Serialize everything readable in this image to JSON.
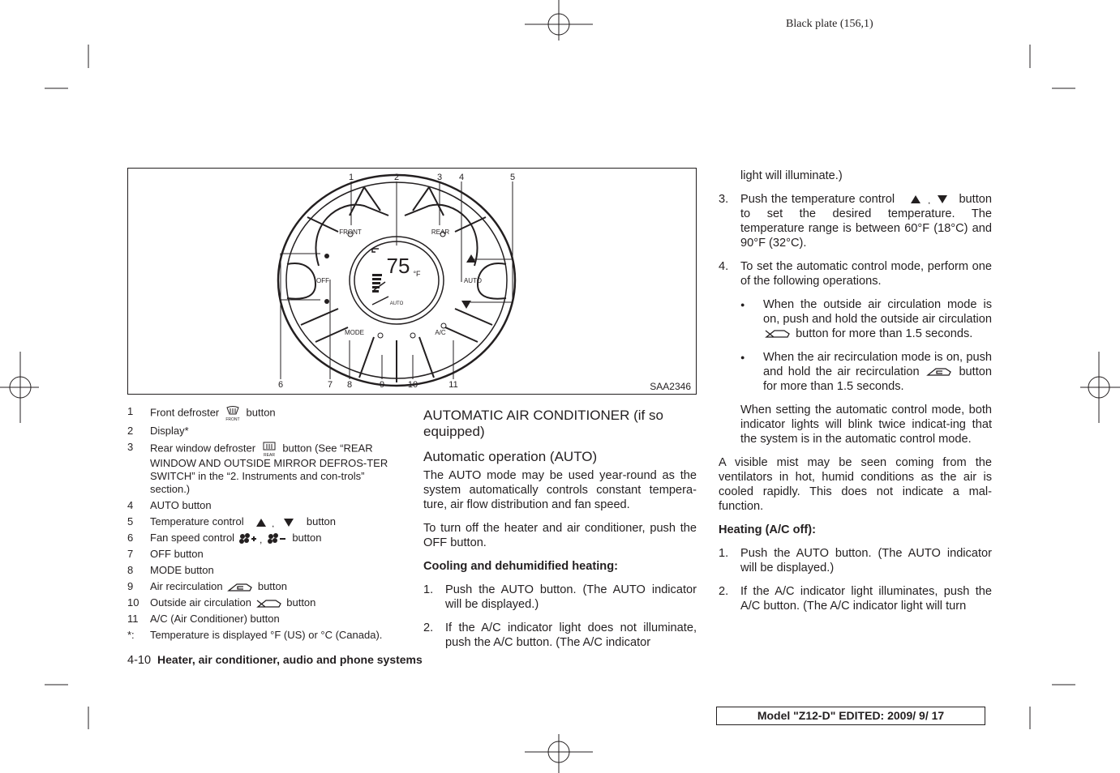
{
  "plate": "Black plate (156,1)",
  "figure": {
    "code": "SAA2346",
    "callouts": [
      "1",
      "2",
      "3",
      "4",
      "5",
      "6",
      "7",
      "8",
      "9",
      "10",
      "11"
    ],
    "labels": {
      "front": "FRONT",
      "rear": "REAR",
      "off": "OFF",
      "auto": "AUTO",
      "mode": "MODE",
      "ac": "A/C",
      "temp": "75",
      "unit": "°F",
      "display_auto": "AUTO"
    }
  },
  "legend": [
    {
      "n": "1",
      "pre": "Front defroster",
      "icon": "front-defroster-icon",
      "post": "button"
    },
    {
      "n": "2",
      "pre": "Display*"
    },
    {
      "n": "3",
      "pre": "Rear window defroster",
      "icon": "rear-defroster-icon",
      "post": "button (See “REAR WINDOW AND OUTSIDE MIRROR DEFROS-TER SWITCH” in the “2. Instruments and con-trols” section.)"
    },
    {
      "n": "4",
      "pre": "AUTO button"
    },
    {
      "n": "5",
      "pre": "Temperature control",
      "icon": "up-down-triangle-icon",
      "post": "button"
    },
    {
      "n": "6",
      "pre": "Fan speed control",
      "icon": "fan-plus-minus-icon",
      "post": "button"
    },
    {
      "n": "7",
      "pre": "OFF button"
    },
    {
      "n": "8",
      "pre": "MODE button"
    },
    {
      "n": "9",
      "pre": "Air recirculation",
      "icon": "recirculation-icon",
      "post": "button"
    },
    {
      "n": "10",
      "pre": "Outside air circulation",
      "icon": "outside-air-icon",
      "post": "button"
    },
    {
      "n": "11",
      "pre": "A/C (Air Conditioner) button"
    },
    {
      "n": "*:",
      "pre": "Temperature is displayed °F (US) or °C (Canada)."
    }
  ],
  "middle": {
    "heading": "AUTOMATIC AIR CONDITIONER (if so equipped)",
    "subheading": "Automatic operation (AUTO)",
    "p1": "The AUTO mode may be used year-round as the system automatically controls constant tempera-ture, air flow distribution and fan speed.",
    "p2": "To turn off the heater and air conditioner, push the OFF button.",
    "cooling_heading": "Cooling and dehumidified heating:",
    "steps": [
      {
        "n": "1.",
        "t": "Push the AUTO button. (The AUTO indicator will be displayed.)"
      },
      {
        "n": "2.",
        "t": "If the A/C indicator light does not illuminate, push the A/C button. (The A/C indicator"
      }
    ]
  },
  "right": {
    "cont": "light will illuminate.)",
    "step3_n": "3.",
    "step3_a": "Push the temperature control",
    "step3_b": "button to set the desired temperature. The temperature range is between 60°F (18°C) and 90°F (32°C).",
    "step4_n": "4.",
    "step4": "To set the automatic control mode, perform one of the following operations.",
    "bullet1_a": "When the outside air circulation mode is on, push and hold the outside air circulation",
    "bullet1_b": "button for more than 1.5 seconds.",
    "bullet2_a": "When the air recirculation mode is on, push and hold the air recirculation",
    "bullet2_b": "button for more than 1.5 seconds.",
    "bullet": "●",
    "p_auto": "When setting the automatic control mode, both indicator lights will blink twice indicat-ing that the system is in the automatic control mode.",
    "p_mist": "A visible mist may be seen coming from the ventilators in hot, humid conditions as the air is cooled rapidly. This does not indicate a mal-function.",
    "heating_heading": "Heating (A/C off):",
    "steps": [
      {
        "n": "1.",
        "t": "Push the AUTO button. (The AUTO indicator will be displayed.)"
      },
      {
        "n": "2.",
        "t": "If the A/C indicator light illuminates, push the A/C button. (The A/C indicator light will turn"
      }
    ]
  },
  "footer": {
    "page": "4-10",
    "section": "Heater, air conditioner, audio and phone systems"
  },
  "model": "Model \"Z12-D\"  EDITED:  2009/ 9/ 17"
}
